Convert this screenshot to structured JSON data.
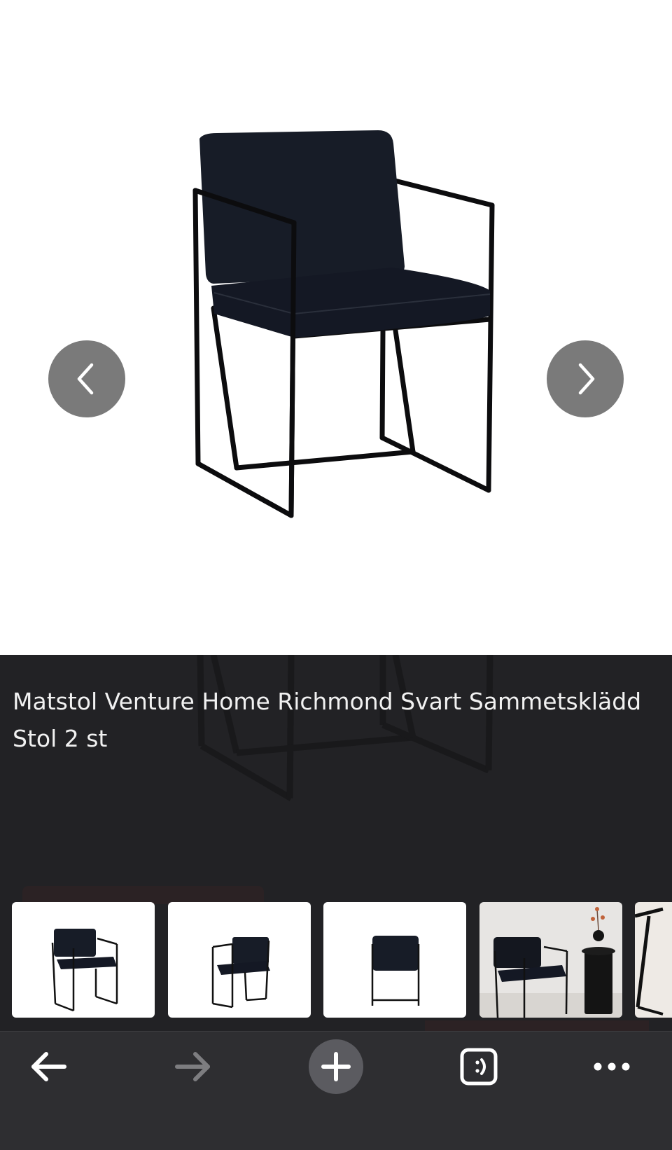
{
  "product": {
    "title": "Matstol Venture Home Richmond Svart Sammetsklädd Stol 2 st"
  },
  "gallery": {
    "prev_icon": "chevron-left-icon",
    "next_icon": "chevron-right-icon",
    "thumbnail_count": 5
  },
  "toolbar": {
    "items": [
      "back-icon",
      "forward-icon",
      "new-tab-icon",
      "tab-switcher-icon",
      "more-icon"
    ]
  },
  "colors": {
    "viewer_bg": "#222225",
    "toolbar_bg": "#2e2e31",
    "nav_arrow": "#7a7a7a"
  }
}
